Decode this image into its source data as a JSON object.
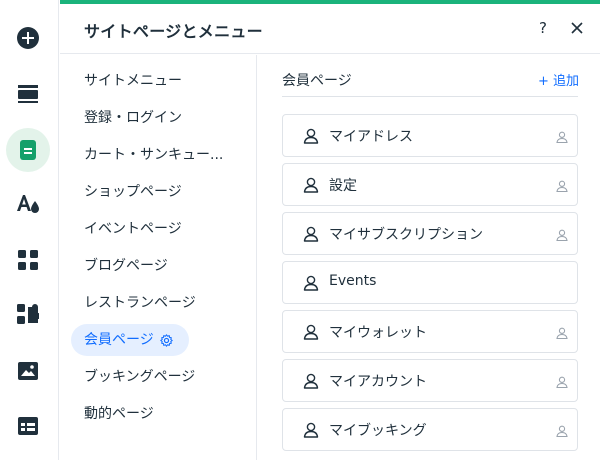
{
  "panel": {
    "title": "サイトページとメニュー",
    "help_label": "?",
    "accent_color": "#1ab37b",
    "link_color": "#116dff"
  },
  "rail": {
    "icons": [
      "add-icon",
      "section-icon",
      "pages-icon",
      "theme-icon",
      "apps-icon",
      "app-market-icon",
      "media-icon",
      "table-icon"
    ],
    "active": "pages-icon"
  },
  "menu": {
    "items": [
      {
        "label": "サイトメニュー"
      },
      {
        "label": "登録・ログイン"
      },
      {
        "label": "カート・サンキュー..."
      },
      {
        "label": "ショップページ"
      },
      {
        "label": "イベントページ"
      },
      {
        "label": "ブログページ"
      },
      {
        "label": "レストランページ"
      },
      {
        "label": "会員ページ",
        "selected": true
      },
      {
        "label": "ブッキングページ"
      },
      {
        "label": "動的ページ"
      }
    ]
  },
  "content": {
    "section_title": "会員ページ",
    "add_label": "+ 追加",
    "pages": [
      {
        "label": "マイアドレス",
        "private": true
      },
      {
        "label": "設定",
        "private": true
      },
      {
        "label": "マイサブスクリプション",
        "private": true
      },
      {
        "label": "Events",
        "private": false
      },
      {
        "label": "マイウォレット",
        "private": true
      },
      {
        "label": "マイアカウント",
        "private": true
      },
      {
        "label": "マイブッキング",
        "private": true
      }
    ]
  }
}
